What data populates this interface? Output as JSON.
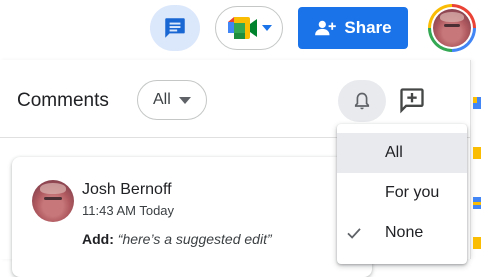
{
  "toolbar": {
    "chat_icon": "comment-history-icon",
    "meet_icon": "google-meet-icon",
    "share_label": "Share",
    "share_icon": "person-add-icon",
    "accent_color": "#1a73e8"
  },
  "comments_panel": {
    "title": "Comments",
    "filter": {
      "selected": "All",
      "icon": "chevron-down-icon"
    },
    "notify_icon": "bell-icon",
    "add_comment_icon": "add-comment-icon",
    "notify_menu": {
      "items": [
        {
          "label": "All",
          "checked": false,
          "highlighted": true
        },
        {
          "label": "For you",
          "checked": false,
          "highlighted": false
        },
        {
          "label": "None",
          "checked": true,
          "highlighted": false
        }
      ]
    },
    "comments": [
      {
        "author": "Josh Bernoff",
        "time": "11:43 AM Today",
        "action": "Add:",
        "text": "“here’s a suggested edit”"
      }
    ]
  }
}
